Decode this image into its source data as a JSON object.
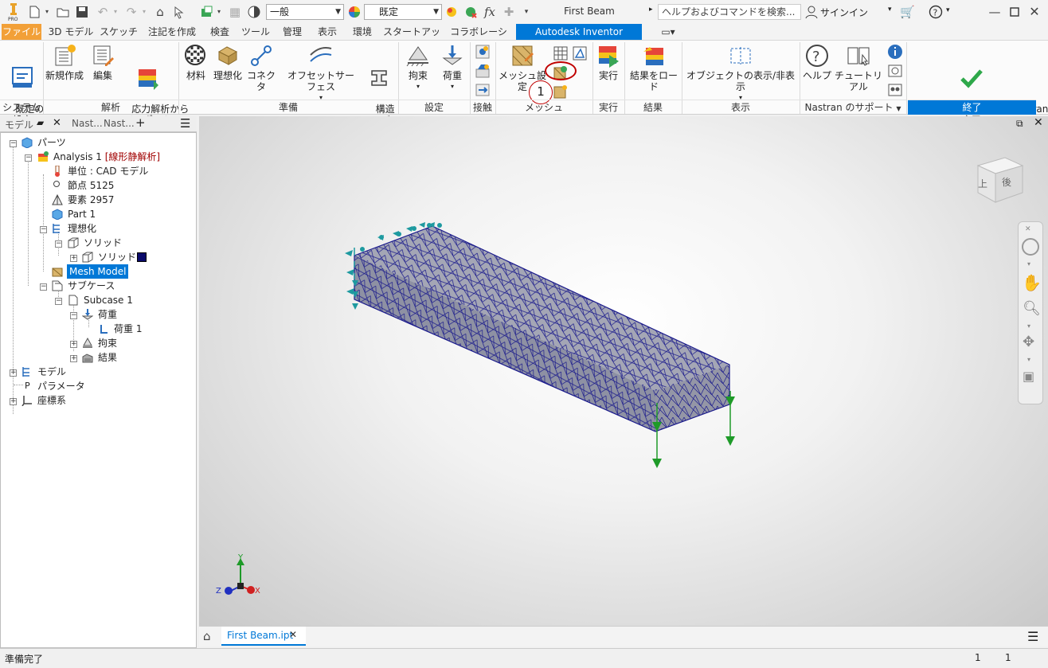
{
  "qat": {
    "style_combo": "一般",
    "material_combo": "既定",
    "doc_title": "First Beam",
    "search_placeholder": "ヘルプおよびコマンドを検索...",
    "signin": "サインイン",
    "fx": "fx"
  },
  "tabs": [
    {
      "label": "ファイル"
    },
    {
      "label": "3D モデル"
    },
    {
      "label": "スケッチ"
    },
    {
      "label": "注記を作成"
    },
    {
      "label": "検査"
    },
    {
      "label": "ツール"
    },
    {
      "label": "管理"
    },
    {
      "label": "表示"
    },
    {
      "label": "環境"
    },
    {
      "label": "スタートアップ"
    },
    {
      "label": "コラボレーション"
    },
    {
      "label": "Autodesk Inventor Nastran"
    }
  ],
  "ribbon": {
    "default_settings": "既定の\n設定",
    "new": "新規作成",
    "edit": "編集",
    "import_stress": "応力解析から\nインポート",
    "material": "材料",
    "idealize": "理想化",
    "connector": "コネクタ",
    "offset_surface": "オフセットサーフェス",
    "structural_member": "構造\nメンバー",
    "constraint": "拘束",
    "load": "荷重",
    "mesh_settings": "メッシュ設定",
    "run": "実行",
    "load_results": "結果をロード",
    "show_hide": "オブジェクトの表示/非表示",
    "help": "ヘルプ",
    "tutorial": "チュートリアル",
    "finish": "Autodesk Inventor Nastran を\n完了",
    "callout_number": "1",
    "panels": {
      "system": "システム",
      "analysis": "解析",
      "prepare": "準備",
      "setup": "設定",
      "contact": "接触",
      "mesh": "メッシュ",
      "run": "実行",
      "results": "結果",
      "display": "表示",
      "support": "Nastran のサポート",
      "finish": "終了"
    }
  },
  "browser": {
    "tabs": {
      "model": "モデル",
      "nast1": "Nast...",
      "nast2": "Nast..."
    },
    "nodes": [
      {
        "label": "パーツ"
      },
      {
        "label": "Analysis 1",
        "suffix": "[線形静解析]"
      },
      {
        "label": "単位 : CAD モデル"
      },
      {
        "label": "節点 5125"
      },
      {
        "label": "要素 2957"
      },
      {
        "label": "Part 1"
      },
      {
        "label": "理想化"
      },
      {
        "label": "ソリッド"
      },
      {
        "label": "ソリッド 1"
      },
      {
        "label": "Mesh Model"
      },
      {
        "label": "サブケース"
      },
      {
        "label": "Subcase 1"
      },
      {
        "label": "荷重"
      },
      {
        "label": "荷重 1"
      },
      {
        "label": "拘束"
      },
      {
        "label": "結果"
      },
      {
        "label": "モデル"
      },
      {
        "label": "パラメータ"
      },
      {
        "label": "座標系"
      }
    ],
    "param_glyph": "P"
  },
  "viewcube": {
    "face_front": "上",
    "face_right": "後"
  },
  "triad": {
    "x": "X",
    "y": "Y",
    "z": "Z"
  },
  "doc_tab": {
    "label": "First Beam.ipt",
    "close": "✕"
  },
  "status": {
    "text": "準備完了",
    "count1": "1",
    "count2": "1"
  },
  "colors": {
    "accent": "#0078d7",
    "mesh_edge": "#1a1a8c",
    "mesh_face": "#9a9cab",
    "constraint": "#1e9aa0",
    "load": "#1e9a28",
    "callout": "#c00000",
    "file_tab": "#f2a038",
    "finish_green": "#2ea84a"
  }
}
